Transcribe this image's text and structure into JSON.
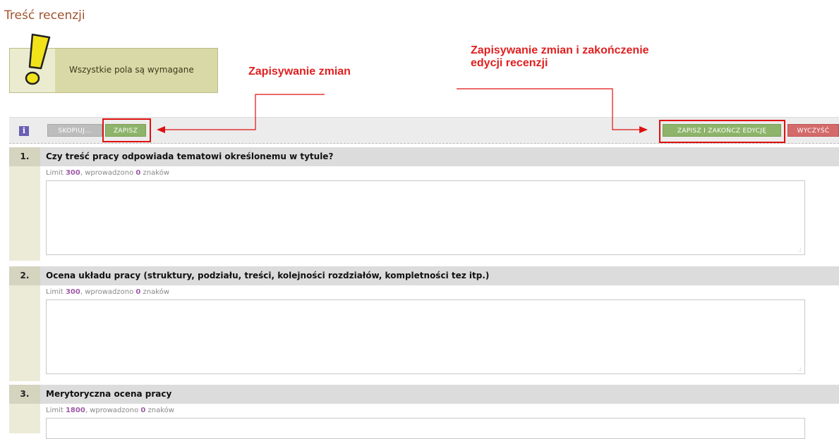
{
  "page": {
    "title": "Treść recenzji"
  },
  "notice": {
    "text": "Wszystkie pola są wymagane",
    "icon": "exclamation-icon"
  },
  "annotations": {
    "save": "Zapisywanie zmian",
    "save_finish_line1": "Zapisywanie zmian i zakończenie",
    "save_finish_line2": "edycji recenzji"
  },
  "toolbar": {
    "info_icon_glyph": "i",
    "copy_label": "SKOPIUJ...",
    "save_label": "ZAPISZ",
    "save_finish_label": "ZAPISZ I ZAKOŃCZ EDYCJĘ",
    "clear_label": "WYCZYŚĆ"
  },
  "questions": [
    {
      "number": "1.",
      "title": "Czy treść pracy odpowiada tematowi określonemu w tytule?",
      "limit_prefix": "Limit ",
      "limit": "300",
      "limit_mid": ", wprowadzono ",
      "entered": "0",
      "limit_suffix": " znaków"
    },
    {
      "number": "2.",
      "title": "Ocena układu pracy (struktury, podziału, treści, kolejności rozdziałów, kompletności tez itp.)",
      "limit_prefix": "Limit ",
      "limit": "300",
      "limit_mid": ", wprowadzono ",
      "entered": "0",
      "limit_suffix": " znaków"
    },
    {
      "number": "3.",
      "title": "Merytoryczna ocena pracy",
      "limit_prefix": "Limit ",
      "limit": "1800",
      "limit_mid": ", wprowadzono ",
      "entered": "0",
      "limit_suffix": " znaków"
    }
  ],
  "colors": {
    "title": "#a0522d",
    "annotation": "#e02020",
    "save_button": "#8db46a",
    "clear_button": "#d46a6a",
    "copy_button": "#bdbdbd"
  }
}
